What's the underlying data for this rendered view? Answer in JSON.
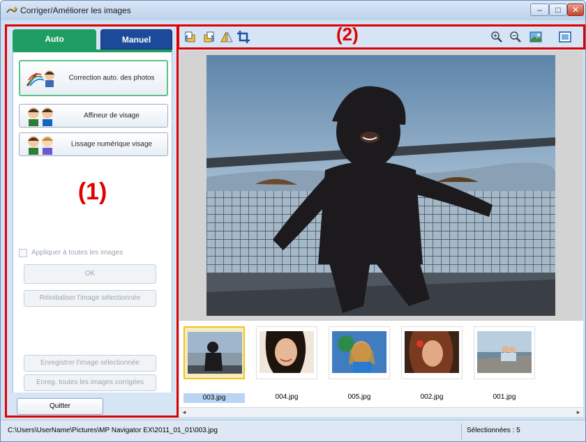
{
  "window": {
    "title": "Corriger/Améliorer les images"
  },
  "left_panel": {
    "tabs": [
      {
        "label": "Auto"
      },
      {
        "label": "Manuel"
      }
    ],
    "mode_buttons": [
      {
        "label": "Correction auto. des photos",
        "icon": "auto-photo-correction-icon"
      },
      {
        "label": "Affineur de visage",
        "icon": "face-sharpener-icon"
      },
      {
        "label": "Lissage numérique visage",
        "icon": "digital-face-smoothing-icon"
      }
    ],
    "region_label": "(1)",
    "apply_all_label": "Appliquer à toutes les images",
    "ok_label": "OK",
    "reset_label": "Réinitialiser l'image sélectionnée",
    "save_selected_label": "Enregistrer l'image sélectionnée",
    "save_all_label": "Enreg. toutes les images corrigées",
    "quit_label": "Quitter"
  },
  "toolbar": {
    "region_label": "(2)",
    "icons": [
      "rotate-left-icon",
      "rotate-right-icon",
      "flip-icon",
      "crop-icon",
      "zoom-in-icon",
      "zoom-out-icon",
      "fit-image-icon",
      "full-screen-icon"
    ]
  },
  "thumbnails": [
    {
      "name": "003.jpg",
      "selected": true
    },
    {
      "name": "004.jpg",
      "selected": false
    },
    {
      "name": "005.jpg",
      "selected": false
    },
    {
      "name": "002.jpg",
      "selected": false
    },
    {
      "name": "001.jpg",
      "selected": false
    }
  ],
  "status": {
    "path": "C:\\Users\\UserName\\Pictures\\MP Navigator EX\\2011_01_01\\003.jpg",
    "selected": "Sélectionnées : 5"
  },
  "colors": {
    "accent_red": "#e00000",
    "tab_auto": "#1f9e63",
    "tab_manual": "#1b4a9b"
  }
}
